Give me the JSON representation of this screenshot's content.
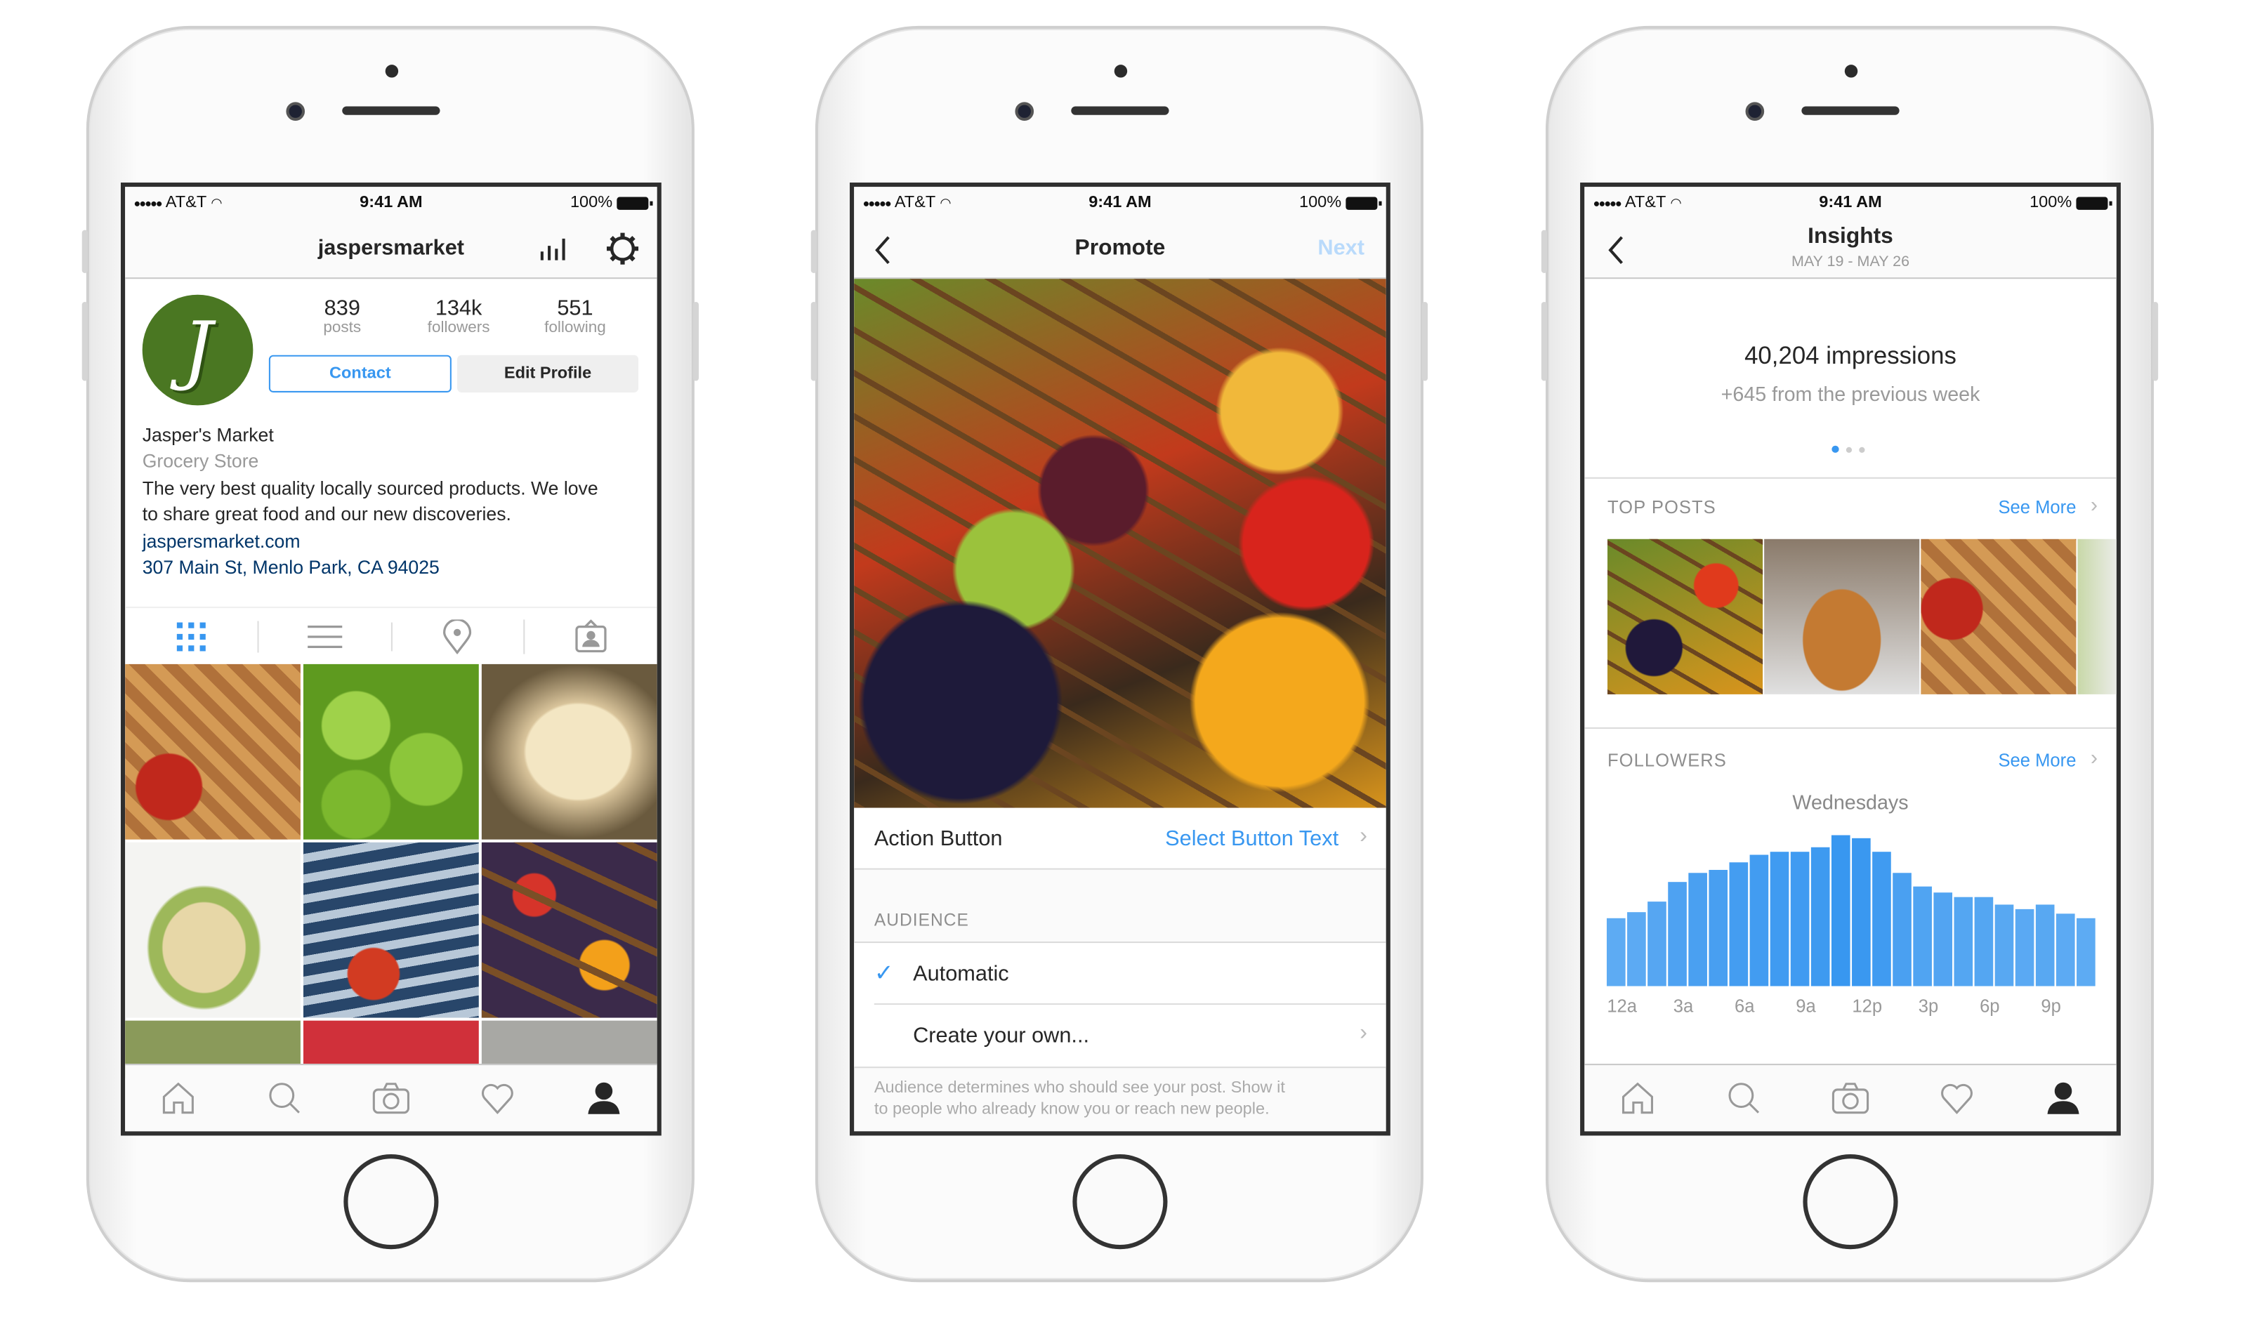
{
  "status": {
    "carrier": "AT&T",
    "time": "9:41 AM",
    "battery": "100%"
  },
  "profile": {
    "username": "jaspersmarket",
    "avatar_letter": "J",
    "stats": [
      {
        "value": "839",
        "label": "posts"
      },
      {
        "value": "134k",
        "label": "followers"
      },
      {
        "value": "551",
        "label": "following"
      }
    ],
    "contact_label": "Contact",
    "edit_label": "Edit Profile",
    "name": "Jasper's Market",
    "category": "Grocery Store",
    "bio_line1": "The very best quality locally sourced products. We love",
    "bio_line2": "to share great food and our new discoveries.",
    "website": "jaspersmarket.com",
    "address": "307 Main St, Menlo Park, CA 94025",
    "view_tabs": [
      "grid-icon",
      "list-icon",
      "location-pin-icon",
      "tagged-icon"
    ],
    "active_view_tab": "grid-icon"
  },
  "promote": {
    "title": "Promote",
    "next_label": "Next",
    "action_button_label": "Action Button",
    "action_button_value": "Select Button Text",
    "audience_header": "AUDIENCE",
    "options": [
      {
        "label": "Automatic",
        "selected": true
      },
      {
        "label": "Create your own...",
        "selected": false
      }
    ],
    "footer_line1": "Audience determines who should see your post. Show it",
    "footer_line2": "to people who already know you or reach new people."
  },
  "insights": {
    "title": "Insights",
    "date_range": "MAY 19 - MAY 26",
    "impressions": "40,204 impressions",
    "change": "+645 from the previous week",
    "page_index": 1,
    "page_count": 3,
    "top_posts_label": "TOP POSTS",
    "followers_label": "FOLLOWERS",
    "see_more": "See More",
    "accent": "#3897f0"
  },
  "tabbar": [
    "home-icon",
    "search-icon",
    "camera-icon",
    "heart-icon",
    "profile-icon"
  ],
  "chart_data": {
    "type": "bar",
    "title": "Wednesdays",
    "categories": [
      "12a",
      "1a",
      "2a",
      "3a",
      "4a",
      "5a",
      "6a",
      "7a",
      "8a",
      "9a",
      "10a",
      "11a",
      "12p",
      "1p",
      "2p",
      "3p",
      "4p",
      "5p",
      "6p",
      "7p",
      "8p",
      "9p",
      "10p",
      "11p"
    ],
    "tick_labels": [
      "12a",
      "3a",
      "6a",
      "9a",
      "12p",
      "3p",
      "6p",
      "9p"
    ],
    "values": [
      45,
      49,
      56,
      69,
      75,
      77,
      82,
      87,
      89,
      89,
      92,
      100,
      98,
      89,
      75,
      66,
      62,
      59,
      59,
      54,
      51,
      54,
      48,
      45
    ],
    "ylim": [
      0,
      100
    ],
    "grid": false,
    "color": "#3897f0"
  }
}
